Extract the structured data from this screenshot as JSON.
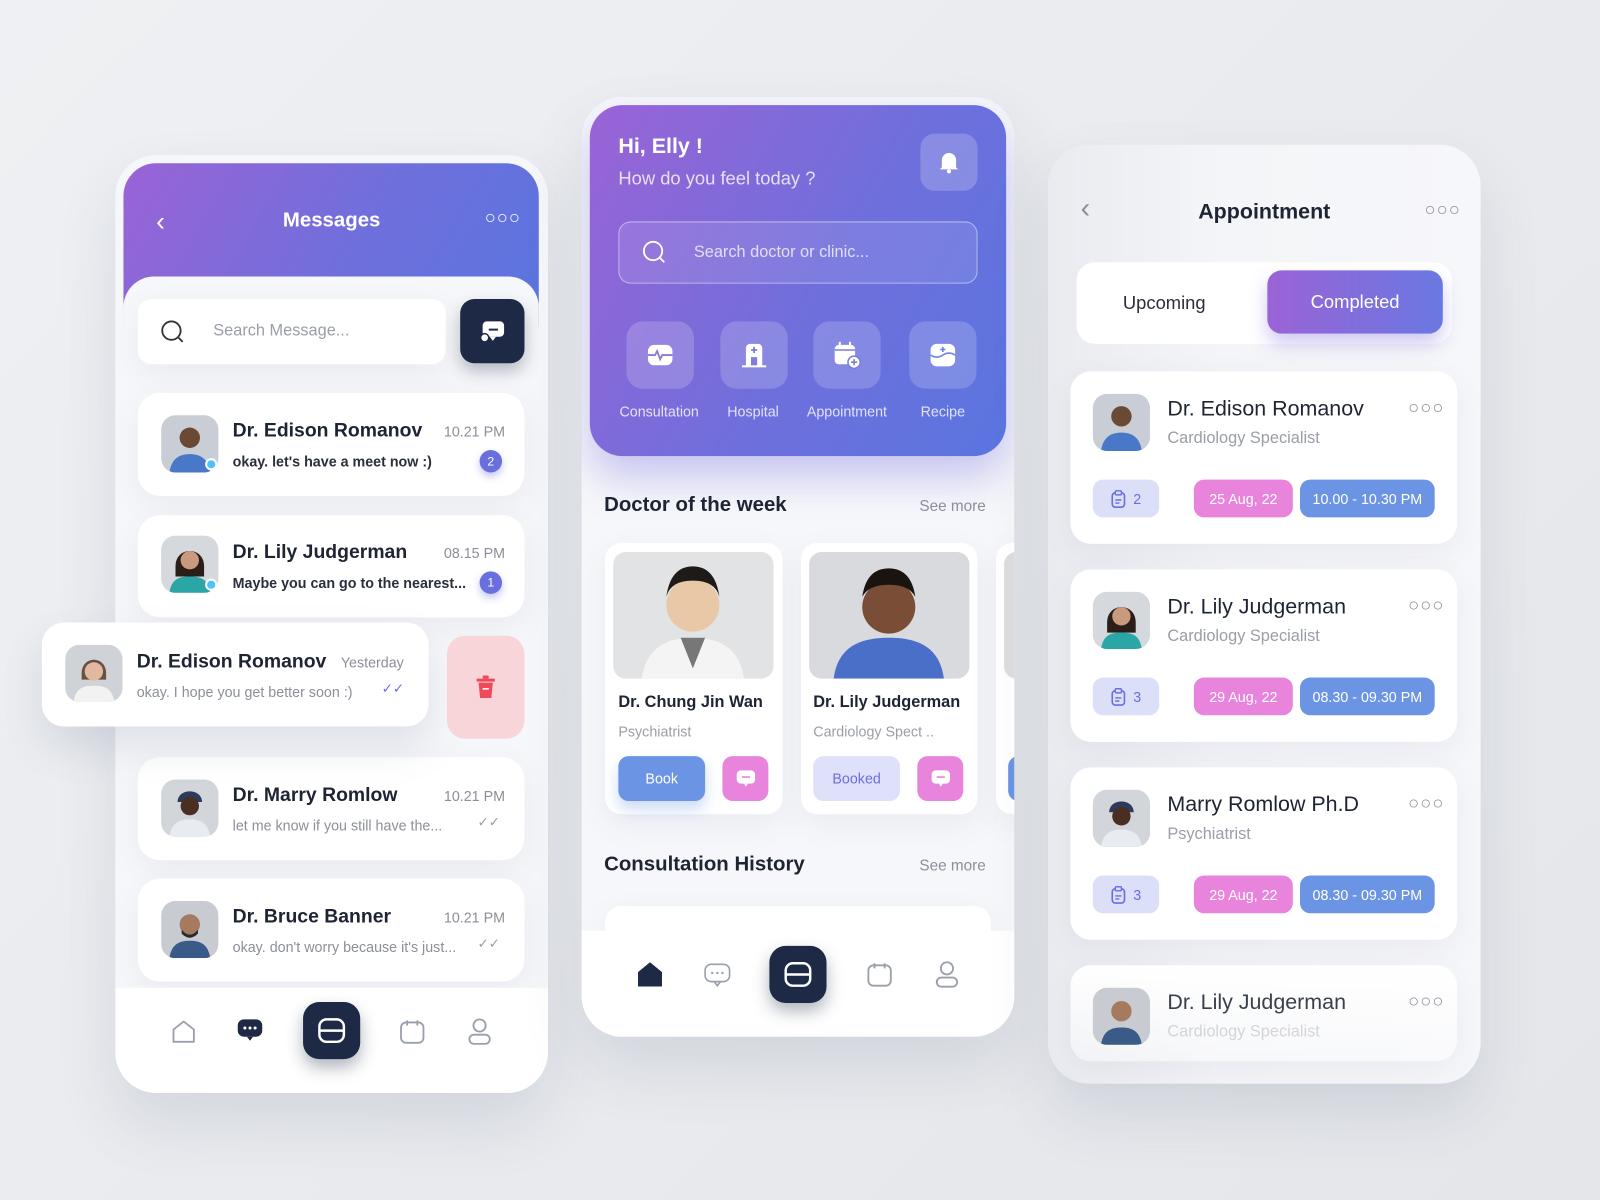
{
  "messages_screen": {
    "title": "Messages",
    "search_placeholder": "Search Message...",
    "items": [
      {
        "name": "Dr. Edison Romanov",
        "time": "10.21 PM",
        "message": "okay. let's have a meet now :)",
        "unread": "2",
        "online": true
      },
      {
        "name": "Dr. Lily Judgerman",
        "time": "08.15 PM",
        "message": "Maybe you can go to the nearest...",
        "unread": "1",
        "online": true
      },
      {
        "name": "Dr. Edison Romanov",
        "time": "Yesterday",
        "message": "okay. I hope you get better soon :)",
        "status": "read"
      },
      {
        "name": "Dr. Marry Romlow",
        "time": "10.21 PM",
        "message": "let me know if you still have the...",
        "status": "read"
      },
      {
        "name": "Dr. Bruce Banner",
        "time": "10.21 PM",
        "message": "okay. don't worry because it's just...",
        "status": "read"
      }
    ],
    "nav": [
      "home-icon",
      "chat-icon",
      "scan-icon",
      "calendar-icon",
      "profile-icon"
    ],
    "active_nav": "chat-icon"
  },
  "home_screen": {
    "greeting": "Hi, Elly !",
    "subtitle": "How do you feel today ?",
    "search_placeholder": "Search doctor or clinic...",
    "quick_actions": [
      {
        "label": "Consultation",
        "icon": "heartbeat-icon"
      },
      {
        "label": "Hospital",
        "icon": "hospital-icon"
      },
      {
        "label": "Appointment",
        "icon": "calendar-plus-icon"
      },
      {
        "label": "Recipe",
        "icon": "medicine-icon"
      }
    ],
    "doctor_of_week": {
      "title": "Doctor of the week",
      "see_more": "See more",
      "doctors": [
        {
          "name": "Dr. Chung Jin Wan",
          "specialty": "Psychiatrist",
          "action": "Book"
        },
        {
          "name": "Dr. Lily Judgerman",
          "specialty": "Cardiology Spect ..",
          "action": "Booked"
        }
      ]
    },
    "consultation_history": {
      "title": "Consultation History",
      "see_more": "See more"
    },
    "active_nav": "home-icon"
  },
  "appointment_screen": {
    "title": "Appointment",
    "tabs": [
      "Upcoming",
      "Completed"
    ],
    "active_tab": "Completed",
    "items": [
      {
        "name": "Dr. Edison Romanov",
        "specialty": "Cardiology Specialist",
        "count": "2",
        "date": "25 Aug, 22",
        "time": "10.00 - 10.30 PM"
      },
      {
        "name": "Dr. Lily Judgerman",
        "specialty": "Cardiology Specialist",
        "count": "3",
        "date": "29 Aug, 22",
        "time": "08.30 - 09.30 PM"
      },
      {
        "name": "Marry Romlow Ph.D",
        "specialty": "Psychiatrist",
        "count": "3",
        "date": "29 Aug, 22",
        "time": "08.30 - 09.30 PM"
      },
      {
        "name": "Dr. Lily Judgerman",
        "specialty": "Cardiology Specialist"
      }
    ]
  },
  "colors": {
    "accent": "#6a6fe0",
    "navy": "#1e2a45",
    "pink": "#e884dc",
    "blue": "#6b95e4",
    "delete_bg": "#f8d5d8"
  }
}
